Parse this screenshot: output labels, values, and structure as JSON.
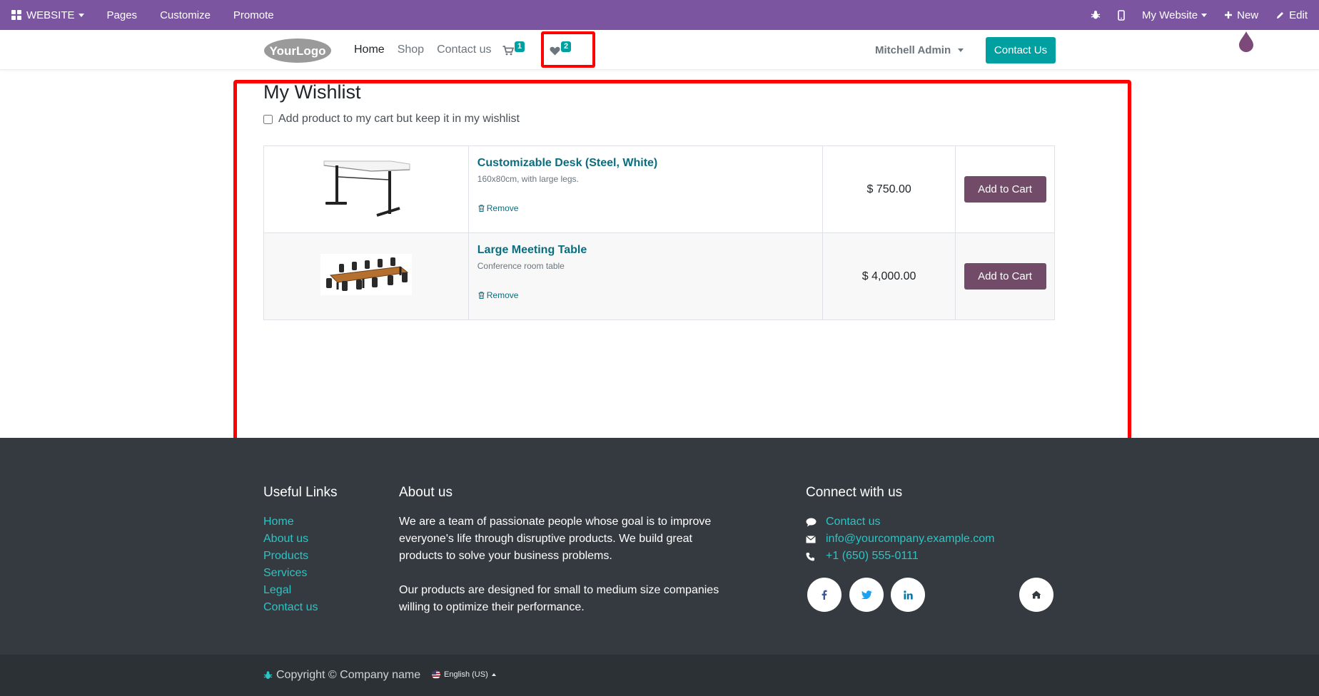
{
  "adminbar": {
    "website_label": "WEBSITE",
    "pages_label": "Pages",
    "customize_label": "Customize",
    "promote_label": "Promote",
    "site_selector": "My Website",
    "new_label": "New",
    "edit_label": "Edit"
  },
  "header": {
    "logo_text": "YourLogo",
    "nav": [
      "Home",
      "Shop",
      "Contact us"
    ],
    "cart_count": "1",
    "wishlist_count": "2",
    "user_name": "Mitchell Admin",
    "contact_button": "Contact Us"
  },
  "main": {
    "title": "My Wishlist",
    "keep_in_wishlist_label": "Add product to my cart but keep it in my wishlist",
    "items": [
      {
        "name": "Customizable Desk (Steel, White)",
        "description": "160x80cm, with large legs.",
        "remove_label": "Remove",
        "price": "$ 750.00",
        "add_to_cart_label": "Add to Cart"
      },
      {
        "name": "Large Meeting Table",
        "description": "Conference room table",
        "remove_label": "Remove",
        "price": "$ 4,000.00",
        "add_to_cart_label": "Add to Cart"
      }
    ]
  },
  "footer": {
    "useful_links_title": "Useful Links",
    "useful_links": [
      "Home",
      "About us",
      "Products",
      "Services",
      "Legal",
      "Contact us"
    ],
    "about_title": "About us",
    "about_p1": "We are a team of passionate people whose goal is to improve everyone's life through disruptive products. We build great products to solve your business problems.",
    "about_p2": "Our products are designed for small to medium size companies willing to optimize their performance.",
    "connect_title": "Connect with us",
    "connect_contact": "Contact us",
    "connect_email": "info@yourcompany.example.com",
    "connect_phone": "+1 (650) 555-0111",
    "copyright": "Copyright © Company name",
    "language": "English (US)"
  },
  "colors": {
    "adminbar": "#7c55a0",
    "primary": "#01a0a0",
    "secondary": "#714b67",
    "footer": "#343a40",
    "highlight": "#ff0000"
  }
}
